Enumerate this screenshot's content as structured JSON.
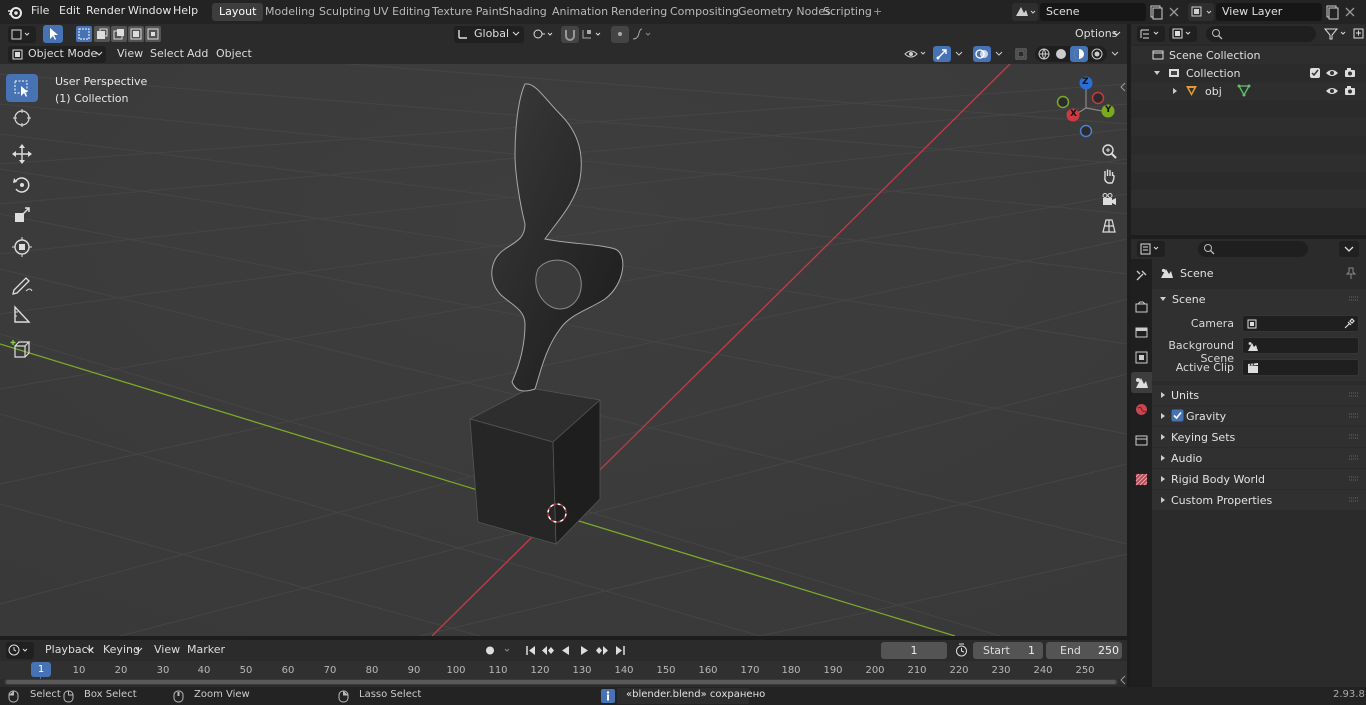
{
  "topbar": {
    "menus": [
      "File",
      "Edit",
      "Render",
      "Window",
      "Help"
    ],
    "workspaces": [
      "Layout",
      "Modeling",
      "Sculpting",
      "UV Editing",
      "Texture Paint",
      "Shading",
      "Animation",
      "Rendering",
      "Compositing",
      "Geometry Nodes",
      "Scripting"
    ],
    "active_workspace": "Layout",
    "add_tab": "+",
    "scene_name": "Scene",
    "view_layer_name": "View Layer"
  },
  "viewport_header": {
    "mode": "Object Mode",
    "menus": [
      "View",
      "Select",
      "Add",
      "Object"
    ],
    "orientation": "Global",
    "options": "Options"
  },
  "viewport": {
    "perspective_label": "User Perspective",
    "collection_label": "(1) Collection",
    "gizmo_axes": {
      "x": "X",
      "y": "Y",
      "z": "Z"
    },
    "colors": {
      "x_axis": "#c63a45",
      "y_axis": "#7aa82a",
      "grid": "#434343"
    }
  },
  "outliner": {
    "scene_collection": "Scene Collection",
    "collection": "Collection",
    "object": "obj"
  },
  "properties": {
    "context": "Scene",
    "panel": "Scene",
    "fields": [
      {
        "label": "Camera"
      },
      {
        "label": "Background Scene"
      },
      {
        "label": "Active Clip"
      }
    ],
    "sections": [
      "Units",
      "Gravity",
      "Keying Sets",
      "Audio",
      "Rigid Body World",
      "Custom Properties"
    ]
  },
  "timeline": {
    "menus": [
      "Playback",
      "Keying",
      "View",
      "Marker"
    ],
    "current_frame": "1",
    "start_label": "Start",
    "start_value": "1",
    "end_label": "End",
    "end_value": "250",
    "ruler": [
      "10",
      "20",
      "30",
      "40",
      "50",
      "60",
      "70",
      "80",
      "90",
      "100",
      "110",
      "120",
      "130",
      "140",
      "150",
      "160",
      "170",
      "180",
      "190",
      "200",
      "210",
      "220",
      "230",
      "240",
      "250"
    ],
    "ruler_current": "1"
  },
  "statusbar": {
    "select": "Select",
    "box_select": "Box Select",
    "zoom_view": "Zoom View",
    "lasso_select": "Lasso Select",
    "message": "«blender.blend» сохранено",
    "version": "2.93.8"
  }
}
